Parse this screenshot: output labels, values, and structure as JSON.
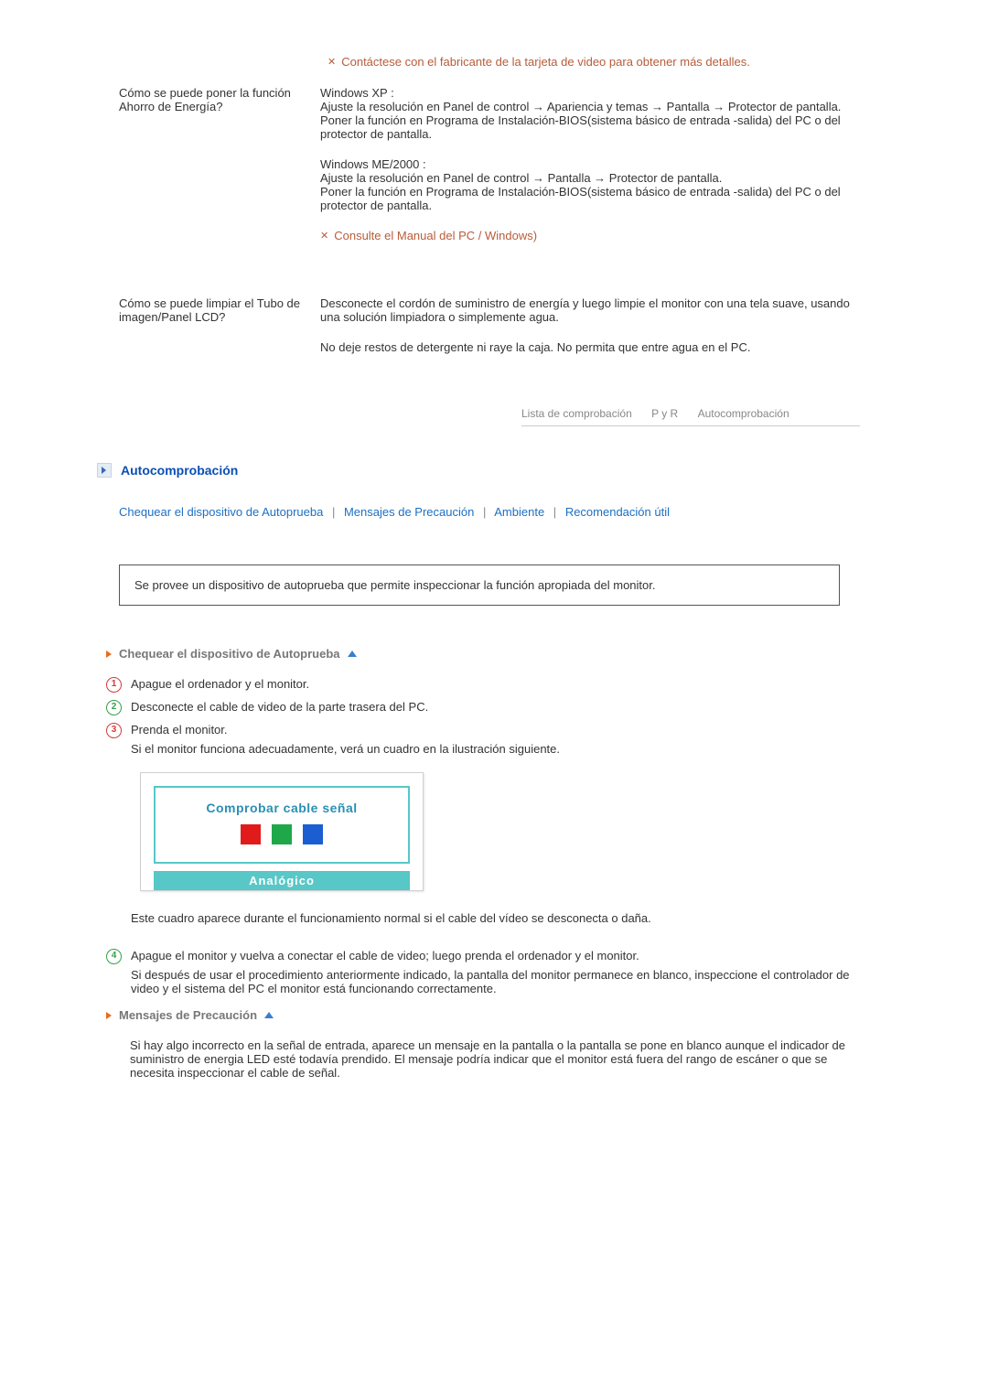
{
  "top_note": "Contáctese con el fabricante de la tarjeta de video para obtener más detalles.",
  "qa1": {
    "q": "Cómo se puede poner la función Ahorro de Energía?",
    "a1": "Windows XP :\nAjuste la resolución en Panel de control → Apariencia y temas → Pantalla → Protector de pantalla.\nPoner la función en Programa de Instalación-BIOS(sistema básico de entrada -salida) del PC o del protector de pantalla.",
    "a2": "Windows ME/2000 :\nAjuste la resolución en Panel de control → Pantalla → Protector de pantalla.\nPoner la función en Programa de Instalación-BIOS(sistema básico de entrada -salida) del PC o del protector de pantalla.",
    "note": "Consulte el Manual del PC / Windows)"
  },
  "qa2": {
    "q": "Cómo se puede limpiar el Tubo de imagen/Panel LCD?",
    "a1": "Desconecte el cordón de suministro de energía y luego limpie el monitor con una tela suave, usando una solución limpiadora o simplemente agua.",
    "a2": "No deje restos de detergente ni raye la caja. No permita que entre agua en el PC."
  },
  "tabs": {
    "t1": "Lista de comprobación",
    "t2": "P y R",
    "t3": "Autocomprobación"
  },
  "section": {
    "title": "Autocomprobación",
    "links": {
      "l1": "Chequear el dispositivo de Autoprueba",
      "l2": "Mensajes de Precaución",
      "l3": "Ambiente",
      "l4": "Recomendación útil"
    },
    "callout": "Se provee un dispositivo de autoprueba que permite inspeccionar la función apropiada del monitor.",
    "sub1": "Chequear el dispositivo de Autoprueba",
    "steps": {
      "s1": "Apague el ordenador y el monitor.",
      "s2": "Desconecte el cable de video de la parte trasera del PC.",
      "s3": "Prenda el monitor.",
      "s3b": "Si el monitor funciona adecuadamente, verá un cuadro en la ilustración siguiente.",
      "illus_title": "Comprobar cable señal",
      "illus_footer": "Analógico",
      "after_illus": "Este cuadro aparece durante el funcionamiento normal si el cable del vídeo se desconecta o daña.",
      "s4": "Apague el monitor y vuelva a conectar el cable de video; luego prenda el ordenador y el monitor.",
      "s4b": "Si después de usar el procedimiento anteriormente indicado, la pantalla del monitor permanece en blanco, inspeccione el controlador de video y el sistema del PC el monitor está funcionando correctamente."
    },
    "sub2": "Mensajes de Precaución",
    "sub2_text": "Si hay algo incorrecto en la señal de entrada, aparece un mensaje en la pantalla o la pantalla se pone en blanco aunque el indicador de suministro de energia LED esté todavía prendido. El mensaje podría indicar que el monitor está fuera del rango de escáner o que se necesita inspeccionar el cable de señal."
  }
}
